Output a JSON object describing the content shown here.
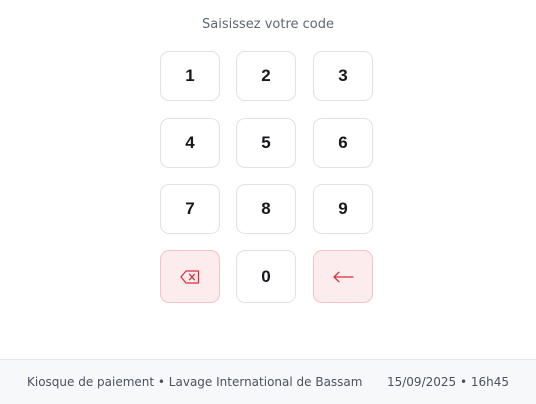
{
  "prompt": "Saisissez votre code",
  "keypad": {
    "digits": [
      "1",
      "2",
      "3",
      "4",
      "5",
      "6",
      "7",
      "8",
      "9",
      "0"
    ],
    "clear_icon": "backspace-icon",
    "back_icon": "arrow-left-icon",
    "danger_color": "#d6313c"
  },
  "footer": {
    "kiosk_label": "Kiosque de paiement • Lavage International de Bassam",
    "datetime": "15/09/2025 • 16h45"
  }
}
